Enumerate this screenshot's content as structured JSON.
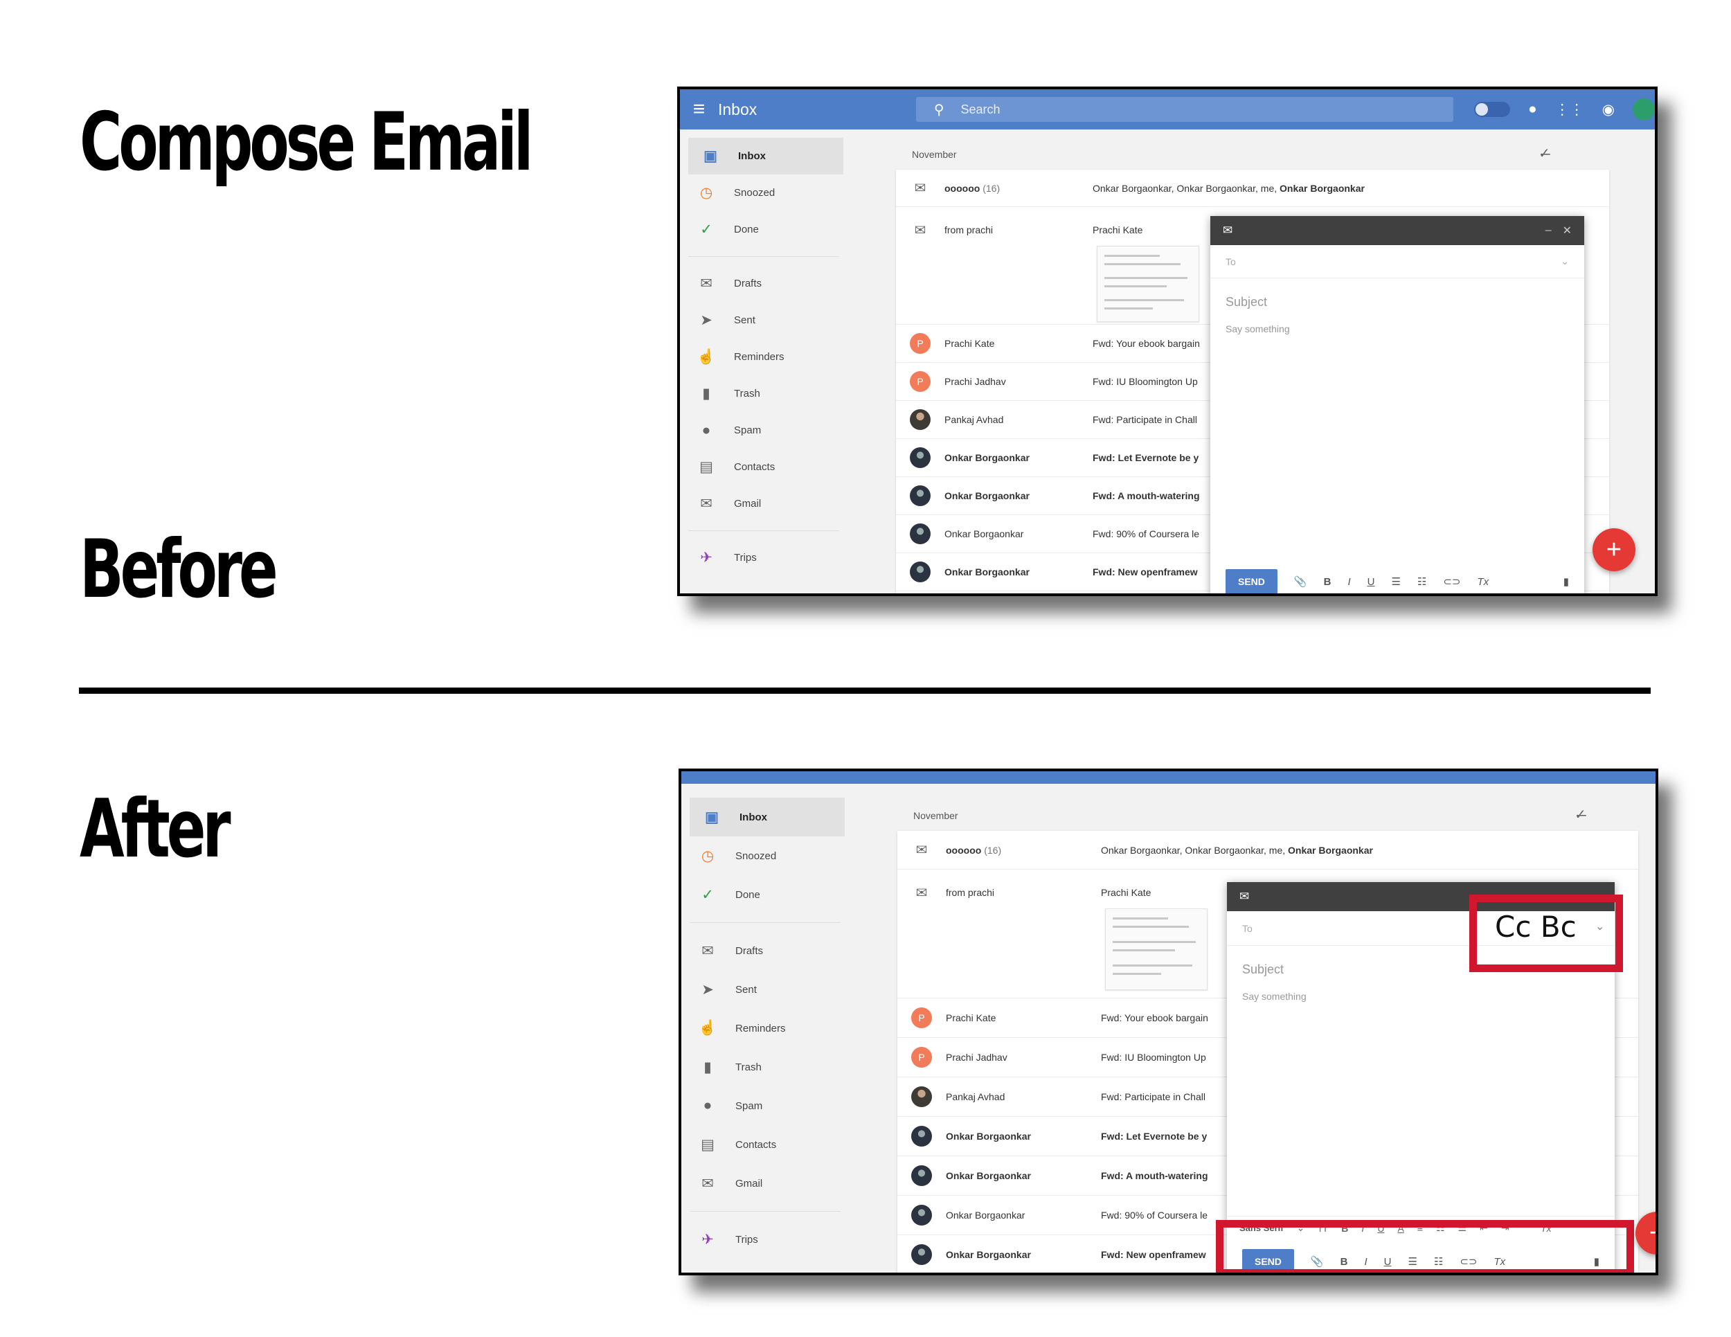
{
  "headings": {
    "title": "Compose Email",
    "before": "Before",
    "after": "After"
  },
  "app": {
    "title": "Inbox",
    "search_placeholder": "Search",
    "icons": [
      "menu-icon",
      "search-icon",
      "pin-toggle-icon",
      "bulb-icon",
      "apps-grid-icon",
      "notifications-icon",
      "account-icon"
    ]
  },
  "sidebar": {
    "items": [
      {
        "label": "Inbox",
        "icon": "▣",
        "color": "#4f7ec9"
      },
      {
        "label": "Snoozed",
        "icon": "◷",
        "color": "#f07b2a"
      },
      {
        "label": "Done",
        "icon": "✓",
        "color": "#2f9e44"
      },
      {
        "label": "Drafts",
        "icon": "✉",
        "color": "#666"
      },
      {
        "label": "Sent",
        "icon": "➤",
        "color": "#555"
      },
      {
        "label": "Reminders",
        "icon": "☝",
        "color": "#555"
      },
      {
        "label": "Trash",
        "icon": "▮",
        "color": "#555"
      },
      {
        "label": "Spam",
        "icon": "●",
        "color": "#555"
      },
      {
        "label": "Contacts",
        "icon": "▤",
        "color": "#555"
      },
      {
        "label": "Gmail",
        "icon": "✉",
        "color": "#555"
      },
      {
        "label": "Trips",
        "icon": "✈",
        "color": "#8e3fb5"
      }
    ]
  },
  "list": {
    "month": "November",
    "rows": [
      {
        "from": "oooooo",
        "count": "(16)",
        "subject_pre": "Onkar Borgaonkar, Onkar Borgaonkar, me, ",
        "subject_bold": "Onkar Borgaonkar",
        "avatar": "env"
      },
      {
        "from": "from prachi",
        "subject": "Prachi Kate",
        "avatar": "env",
        "bundle": true
      },
      {
        "from": "Prachi Kate",
        "subject": "Fwd: Your ebook bargain",
        "avatar": "P"
      },
      {
        "from": "Prachi Jadhav",
        "subject": "Fwd: IU Bloomington Up",
        "avatar": "P"
      },
      {
        "from": "Pankaj Avhad",
        "subject": "Fwd: Participate in Chall",
        "avatar": "photo"
      },
      {
        "from": "Onkar Borgaonkar",
        "subject": "Fwd: Let Evernote be y",
        "avatar": "ob",
        "bold": true
      },
      {
        "from": "Onkar Borgaonkar",
        "subject": "Fwd: A mouth-watering",
        "avatar": "ob",
        "bold": true
      },
      {
        "from": "Onkar Borgaonkar",
        "subject": "Fwd: 90% of Coursera le",
        "avatar": "ob"
      },
      {
        "from": "Onkar Borgaonkar",
        "subject": "Fwd: New openframew",
        "avatar": "ob",
        "bold": true
      }
    ]
  },
  "compose": {
    "to_placeholder": "To",
    "subject_placeholder": "Subject",
    "body_placeholder": "Say something",
    "send_label": "SEND",
    "cc_bcc": "Cc Bc",
    "font_family": "Sans Serif",
    "toolbar_before": [
      "📎",
      "B",
      "I",
      "U",
      "☰",
      "☷",
      "⊂⊃",
      "Tx"
    ],
    "toolbar_after_format": [
      "ᴛT",
      "B",
      "I",
      "U",
      "A",
      "≡",
      "☷",
      "☰",
      "⇤",
      "⇥",
      "❞",
      "Tx"
    ]
  }
}
